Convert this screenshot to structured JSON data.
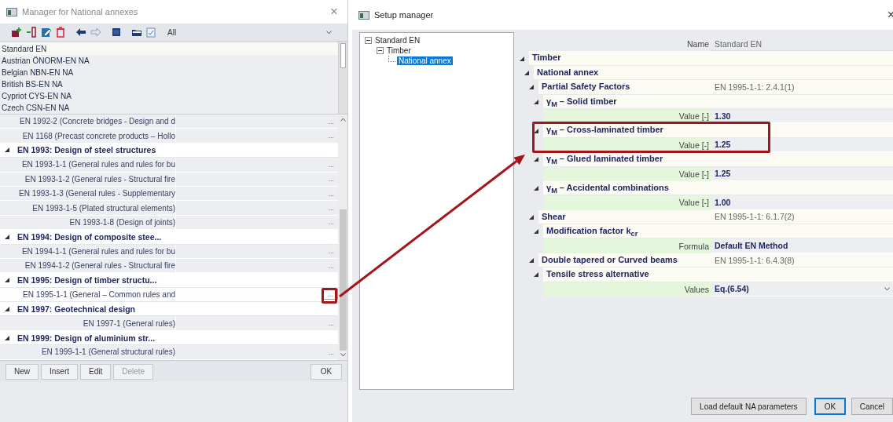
{
  "manager": {
    "title": "Manager for National annexes",
    "close": "×",
    "filter": "All",
    "annexes": [
      {
        "label": "Standard EN",
        "selected": true
      },
      {
        "label": "Austrian ÖNORM-EN NA",
        "selected": false
      },
      {
        "label": "Belgian NBN-EN NA",
        "selected": false
      },
      {
        "label": "British BS-EN NA",
        "selected": false
      },
      {
        "label": "Cypriot CYS-EN NA",
        "selected": false
      },
      {
        "label": "Czech CSN-EN NA",
        "selected": false
      }
    ],
    "documents": [
      {
        "kind": "item",
        "label": "EN 1992-2 (Concrete bridges - Design and d",
        "button": "...",
        "selected": false
      },
      {
        "kind": "item",
        "label": "EN 1168 (Precast concrete products – Hollo",
        "button": "...",
        "selected": false
      },
      {
        "kind": "group",
        "label": "EN 1993: Design of steel structures",
        "expanded": true,
        "children": [
          {
            "kind": "item",
            "label": "EN 1993-1-1 (General rules and rules for bu",
            "button": "...",
            "selected": false
          },
          {
            "kind": "item",
            "label": "EN 1993-1-2 (General rules - Structural fire",
            "button": "...",
            "selected": false
          },
          {
            "kind": "item",
            "label": "EN 1993-1-3 (General rules - Supplementary",
            "button": "...",
            "selected": false
          },
          {
            "kind": "item",
            "label": "EN 1993-1-5 (Plated structural elements)",
            "button": "...",
            "selected": false
          },
          {
            "kind": "item",
            "label": "EN 1993-1-8 (Design of joints)",
            "button": "...",
            "selected": false
          }
        ]
      },
      {
        "kind": "group",
        "label": "EN 1994: Design of composite stee...",
        "expanded": true,
        "children": [
          {
            "kind": "item",
            "label": "EN 1994-1-1 (General rules and rules for bu",
            "button": "...",
            "selected": false
          },
          {
            "kind": "item",
            "label": "EN 1994-1-2 (General rules - Structural fire",
            "button": "...",
            "selected": false
          }
        ]
      },
      {
        "kind": "group",
        "label": "EN 1995: Design of timber structu...",
        "expanded": true,
        "children": [
          {
            "kind": "item",
            "label": "EN 1995-1-1 (General – Common rules and",
            "button": "...",
            "selected": true
          }
        ]
      },
      {
        "kind": "group",
        "label": "EN 1997: Geotechnical design",
        "expanded": true,
        "children": [
          {
            "kind": "item",
            "label": "EN 1997-1 (General rules)",
            "button": "...",
            "selected": false
          }
        ]
      },
      {
        "kind": "group",
        "label": "EN 1999: Design of aluminium str...",
        "expanded": true,
        "children": [
          {
            "kind": "item",
            "label": "EN 1999-1-1 (General structural rules)",
            "button": "...",
            "selected": false
          }
        ]
      }
    ],
    "buttons": [
      {
        "label": "New",
        "disabled": false
      },
      {
        "label": "Insert",
        "disabled": false
      },
      {
        "label": "Edit",
        "disabled": false
      },
      {
        "label": "Delete",
        "disabled": true
      }
    ],
    "ok_button": "OK"
  },
  "setup": {
    "title": "Setup manager",
    "close": "×",
    "tree": [
      {
        "label": "Standard EN",
        "selected": false,
        "expanded": true,
        "children": [
          {
            "label": "Timber",
            "selected": false,
            "expanded": true,
            "children": [
              {
                "label": "National annex",
                "selected": true
              }
            ]
          }
        ]
      }
    ],
    "name_label": "Name",
    "name_value": "Standard EN",
    "properties": [
      {
        "kind": "group",
        "label": "Timber",
        "expanded": true,
        "children": [
          {
            "kind": "group",
            "label": "National annex",
            "expanded": true,
            "children": [
              {
                "kind": "group",
                "label": "Partial Safety Factors",
                "value": "EN 1995-1-1: 2.4.1(1)",
                "expanded": true,
                "children": [
                  {
                    "kind": "group",
                    "label": "γ$_{M}$ – Solid timber",
                    "expanded": true,
                    "children": [
                      {
                        "kind": "property",
                        "label": "Value [-]",
                        "value": "1.30"
                      }
                    ]
                  },
                  {
                    "kind": "group",
                    "label": "γ$_{M}$ – Cross-laminated timber",
                    "expanded": true,
                    "children": [
                      {
                        "kind": "property",
                        "label": "Value [-]",
                        "value": "1.25"
                      }
                    ]
                  },
                  {
                    "kind": "group",
                    "label": "γ$_{M}$ – Glued laminated timber",
                    "expanded": true,
                    "children": [
                      {
                        "kind": "property",
                        "label": "Value [-]",
                        "value": "1.25"
                      }
                    ]
                  },
                  {
                    "kind": "group",
                    "label": "γ$_{M}$ – Accidental combinations",
                    "expanded": true,
                    "children": [
                      {
                        "kind": "property",
                        "label": "Value [-]",
                        "value": "1.00"
                      }
                    ]
                  }
                ]
              },
              {
                "kind": "group",
                "label": "Shear",
                "value": "EN 1995-1-1: 6.1.7(2)",
                "expanded": true,
                "children": [
                  {
                    "kind": "group",
                    "label": "Modification factor k$_{cr}$",
                    "expanded": true,
                    "children": [
                      {
                        "kind": "property",
                        "label": "Formula",
                        "value": "Default EN Method"
                      }
                    ]
                  }
                ]
              },
              {
                "kind": "group",
                "label": "Double tapered or Curved beams",
                "value": "EN 1995-1-1: 6.4.3(8)",
                "expanded": true,
                "children": [
                  {
                    "kind": "group",
                    "label": "Tensile stress alternative",
                    "expanded": true,
                    "children": [
                      {
                        "kind": "dropdown",
                        "label": "Values",
                        "value": "Eq.(6.54)"
                      }
                    ]
                  }
                ]
              }
            ]
          }
        ]
      }
    ],
    "buttons": [
      {
        "label": "Load default NA parameters",
        "default": false
      },
      {
        "label": "OK",
        "default": true
      },
      {
        "label": "Cancel",
        "default": false
      }
    ]
  }
}
